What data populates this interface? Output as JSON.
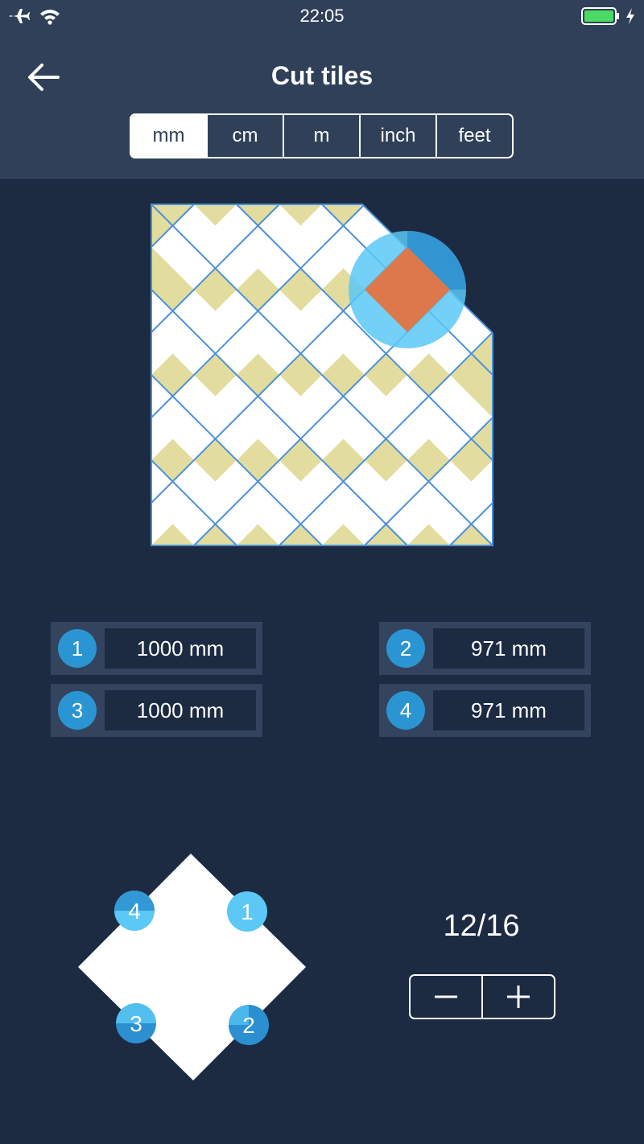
{
  "status_bar": {
    "time": "22:05",
    "icons": [
      "airplane-icon",
      "wifi-icon",
      "battery-icon",
      "charging-icon"
    ],
    "battery_color": "#4cd964"
  },
  "header": {
    "title": "Cut tiles",
    "back_icon": "back-arrow-icon"
  },
  "units": {
    "options": [
      "mm",
      "cm",
      "m",
      "inch",
      "feet"
    ],
    "selected": "mm"
  },
  "measurements": [
    {
      "badge": "1",
      "value": "1000 mm"
    },
    {
      "badge": "2",
      "value": "971 mm"
    },
    {
      "badge": "3",
      "value": "1000 mm"
    },
    {
      "badge": "4",
      "value": "971 mm"
    }
  ],
  "tile_preview": {
    "corner_labels": [
      "4",
      "1",
      "3",
      "2"
    ]
  },
  "counter": {
    "text": "12/16",
    "current": 12,
    "total": 16
  },
  "stepper": {
    "minus_icon": "minus-icon",
    "plus_icon": "plus-icon"
  },
  "colors": {
    "background": "#1c2a42",
    "header": "#2f4058",
    "accent_blue": "#2b95d3",
    "light_blue": "#5bc8f5",
    "tile_white": "#ffffff",
    "border_khaki": "#e2dc9e",
    "grid_line": "#4a90d9",
    "selected_tile": "#dc784c"
  }
}
